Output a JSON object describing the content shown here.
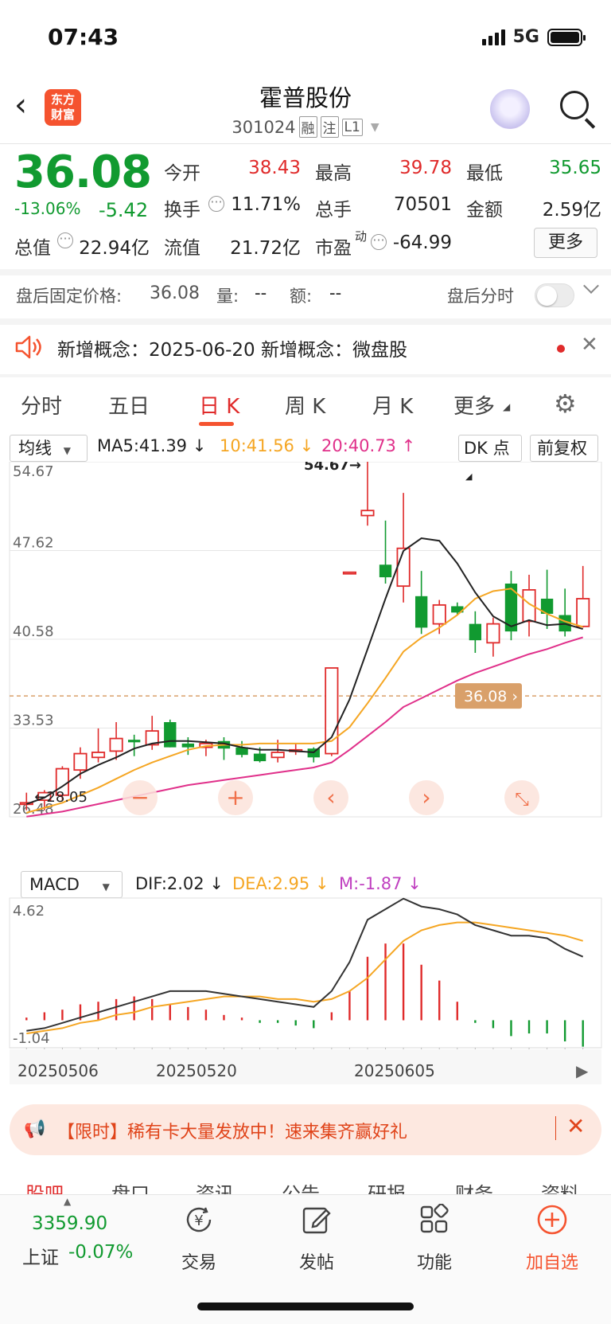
{
  "status": {
    "time": "07:43",
    "network": "5G"
  },
  "header": {
    "logo_line1": "东方",
    "logo_line2": "财富",
    "title": "霍普股份",
    "code": "301024",
    "tags": [
      "融",
      "注",
      "L1"
    ]
  },
  "quote": {
    "price": "36.08",
    "change_pct": "-13.06%",
    "change_abs": "-5.42",
    "open_label": "今开",
    "open": "38.43",
    "high_label": "最高",
    "high": "39.78",
    "low_label": "最低",
    "low": "35.65",
    "turnover_label": "换手",
    "turnover": "11.71%",
    "volume_label": "总手",
    "volume": "70501",
    "amount_label": "金额",
    "amount": "2.59亿",
    "mktcap_label": "总值",
    "mktcap": "22.94亿",
    "float_label": "流值",
    "float": "21.72亿",
    "pe_label": "市盈",
    "pe_sup": "动",
    "pe": "-64.99",
    "more": "更多"
  },
  "after_hours": {
    "label": "盘后固定价格:",
    "price": "36.08",
    "vol_label": "量:",
    "vol": "--",
    "amt_label": "额:",
    "amt": "--",
    "intraday": "盘后分时"
  },
  "notice": {
    "text": "新增概念：2025-06-20 新增概念：微盘股"
  },
  "tabs": [
    "分时",
    "五日",
    "日 K",
    "周 K",
    "月 K",
    "更多"
  ],
  "ma_bar": {
    "selector": "均线",
    "ma5": "MA5:41.39",
    "ma10": "10:41.56",
    "ma20": "20:40.73",
    "dk": "DK 点",
    "adjust": "前复权"
  },
  "macd_bar": {
    "selector": "MACD",
    "dif": "DIF:2.02",
    "dea": "DEA:2.95",
    "m": "M:-1.87"
  },
  "colors": {
    "up": "#e02b2b",
    "down": "#119a30",
    "ma5": "#222222",
    "ma10": "#f5a623",
    "ma20": "#e0308a",
    "price_line": "#d9a06a",
    "accent": "#f5532f"
  },
  "chart_data": {
    "type": "candlestick",
    "y_ticks": [
      "54.67",
      "47.62",
      "40.58",
      "33.53",
      "26.48"
    ],
    "ylim": [
      26.48,
      54.67
    ],
    "current_price_label": "36.08",
    "max_label": "54.67",
    "min_label": "28.05",
    "x_ticks": [
      "20250506",
      "20250520",
      "20250605"
    ],
    "candles": [
      {
        "o": 27.6,
        "h": 28.4,
        "l": 27.0,
        "c": 27.6
      },
      {
        "o": 27.8,
        "h": 28.6,
        "l": 27.0,
        "c": 28.4
      },
      {
        "o": 28.2,
        "h": 30.5,
        "l": 27.8,
        "c": 30.3
      },
      {
        "o": 30.2,
        "h": 32.0,
        "l": 29.5,
        "c": 31.5
      },
      {
        "o": 31.2,
        "h": 33.5,
        "l": 30.8,
        "c": 31.6
      },
      {
        "o": 31.7,
        "h": 34.0,
        "l": 31.0,
        "c": 32.7
      },
      {
        "o": 32.6,
        "h": 33.0,
        "l": 31.3,
        "c": 32.4
      },
      {
        "o": 32.2,
        "h": 34.5,
        "l": 31.8,
        "c": 33.3
      },
      {
        "o": 34.0,
        "h": 34.2,
        "l": 32.0,
        "c": 32.0
      },
      {
        "o": 32.3,
        "h": 32.8,
        "l": 31.4,
        "c": 32.0
      },
      {
        "o": 32.0,
        "h": 32.6,
        "l": 31.3,
        "c": 32.3
      },
      {
        "o": 32.5,
        "h": 32.8,
        "l": 31.0,
        "c": 31.9
      },
      {
        "o": 32.0,
        "h": 32.5,
        "l": 31.2,
        "c": 31.4
      },
      {
        "o": 31.5,
        "h": 32.0,
        "l": 30.8,
        "c": 30.9
      },
      {
        "o": 31.2,
        "h": 32.6,
        "l": 30.8,
        "c": 31.6
      },
      {
        "o": 31.8,
        "h": 32.3,
        "l": 31.4,
        "c": 31.8
      },
      {
        "o": 31.9,
        "h": 32.0,
        "l": 30.8,
        "c": 31.2
      },
      {
        "o": 31.5,
        "h": 38.3,
        "l": 31.3,
        "c": 38.3
      },
      {
        "o": 45.9,
        "h": 45.9,
        "l": 45.9,
        "c": 45.9
      },
      {
        "o": 50.4,
        "h": 54.67,
        "l": 49.6,
        "c": 50.8
      },
      {
        "o": 46.5,
        "h": 50.0,
        "l": 45.0,
        "c": 45.5
      },
      {
        "o": 44.8,
        "h": 52.2,
        "l": 43.5,
        "c": 47.8
      },
      {
        "o": 44.0,
        "h": 46.0,
        "l": 41.0,
        "c": 41.5
      },
      {
        "o": 41.8,
        "h": 43.7,
        "l": 41.0,
        "c": 43.3
      },
      {
        "o": 43.2,
        "h": 43.5,
        "l": 42.5,
        "c": 42.7
      },
      {
        "o": 41.8,
        "h": 42.8,
        "l": 39.5,
        "c": 40.5
      },
      {
        "o": 40.3,
        "h": 42.3,
        "l": 39.2,
        "c": 41.8
      },
      {
        "o": 45.0,
        "h": 46.0,
        "l": 40.5,
        "c": 41.2
      },
      {
        "o": 42.0,
        "h": 45.7,
        "l": 40.8,
        "c": 44.5
      },
      {
        "o": 43.8,
        "h": 46.1,
        "l": 41.4,
        "c": 42.6
      },
      {
        "o": 42.5,
        "h": 44.6,
        "l": 40.8,
        "c": 41.2
      },
      {
        "o": 41.6,
        "h": 46.4,
        "l": 41.5,
        "c": 43.8
      }
    ],
    "ma5": [
      27.5,
      28.0,
      28.9,
      29.9,
      30.6,
      31.2,
      31.9,
      32.3,
      32.5,
      32.5,
      32.4,
      32.3,
      32.0,
      31.8,
      31.8,
      31.7,
      31.6,
      32.8,
      35.8,
      39.8,
      43.8,
      47.6,
      48.6,
      48.4,
      46.6,
      44.3,
      42.4,
      41.6,
      42.1,
      41.7,
      41.8,
      41.39
    ],
    "ma10": [
      26.8,
      27.2,
      27.6,
      28.2,
      28.8,
      29.5,
      30.2,
      30.8,
      31.3,
      31.8,
      32.1,
      32.2,
      32.2,
      32.3,
      32.3,
      32.3,
      32.3,
      32.5,
      33.6,
      35.5,
      37.5,
      39.6,
      40.7,
      41.5,
      42.5,
      43.8,
      44.4,
      44.6,
      43.4,
      42.6,
      42.0,
      41.56
    ],
    "ma20": [
      26.5,
      26.7,
      26.9,
      27.2,
      27.5,
      27.8,
      28.1,
      28.4,
      28.7,
      29.0,
      29.2,
      29.4,
      29.6,
      29.8,
      30.0,
      30.2,
      30.4,
      30.8,
      31.8,
      32.9,
      34.0,
      35.2,
      35.9,
      36.6,
      37.3,
      37.9,
      38.4,
      38.9,
      39.4,
      39.8,
      40.3,
      40.73
    ],
    "macd": {
      "ylim": [
        -1.04,
        4.62
      ],
      "y_ticks": [
        "4.62",
        "-1.04"
      ],
      "dif": [
        -0.4,
        -0.3,
        -0.1,
        0.1,
        0.3,
        0.5,
        0.7,
        0.9,
        1.1,
        1.1,
        1.1,
        1.0,
        0.9,
        0.8,
        0.7,
        0.6,
        0.5,
        1.1,
        2.2,
        3.8,
        4.2,
        4.6,
        4.3,
        4.2,
        4.0,
        3.6,
        3.4,
        3.2,
        3.2,
        3.1,
        2.7,
        2.4
      ],
      "dea": [
        -0.5,
        -0.4,
        -0.3,
        -0.1,
        0.0,
        0.2,
        0.3,
        0.5,
        0.6,
        0.7,
        0.8,
        0.9,
        0.9,
        0.9,
        0.8,
        0.8,
        0.7,
        0.8,
        1.1,
        1.6,
        2.3,
        3.0,
        3.4,
        3.6,
        3.7,
        3.7,
        3.6,
        3.5,
        3.4,
        3.3,
        3.2,
        3.0
      ],
      "m": [
        0.1,
        0.3,
        0.4,
        0.6,
        0.7,
        0.8,
        0.9,
        0.8,
        0.6,
        0.5,
        0.4,
        0.2,
        0.1,
        -0.1,
        -0.1,
        -0.2,
        -0.3,
        0.3,
        1.1,
        2.4,
        2.9,
        2.9,
        2.1,
        1.5,
        0.7,
        -0.1,
        -0.3,
        -0.6,
        -0.5,
        -0.5,
        -0.8,
        -1.0
      ]
    }
  },
  "chart_controls": [
    "minus",
    "plus",
    "prev",
    "next",
    "expand"
  ],
  "promo": {
    "text": "【限时】稀有卡大量发放中！速来集齐赢好礼"
  },
  "info_tabs": [
    "股吧",
    "盘口",
    "资讯",
    "公告",
    "研报",
    "财务",
    "资料"
  ],
  "index": {
    "value": "3359.90",
    "name": "上证",
    "change": "-0.07%"
  },
  "nav": [
    "交易",
    "发帖",
    "功能",
    "加自选"
  ]
}
